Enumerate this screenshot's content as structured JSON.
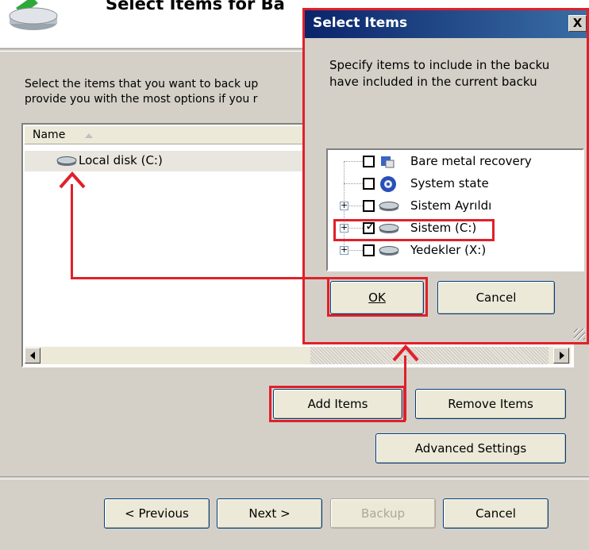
{
  "wizard": {
    "title": "Select Items for Ba",
    "description_line1": "Select the items that you want to back up",
    "description_line2": "provide you with the most options if you r",
    "list": {
      "column_name": "Name",
      "rows": [
        {
          "label": "Local disk (C:)"
        }
      ]
    },
    "buttons": {
      "add_items": "Add Items",
      "remove_items": "Remove Items",
      "advanced_settings": "Advanced Settings",
      "previous": "< Previous",
      "next": "Next >",
      "backup": "Backup",
      "cancel": "Cancel"
    }
  },
  "dialog": {
    "title": "Select Items",
    "close": "X",
    "description_line1": "Specify items to include in the backu",
    "description_line2": "have included in the current backu",
    "tree_items": [
      {
        "label": "Bare metal recovery",
        "checked": false,
        "icon": "bare-metal-icon"
      },
      {
        "label": "System state",
        "checked": false,
        "icon": "system-state-icon"
      },
      {
        "label": "Sistem Ayrıldı",
        "checked": false,
        "icon": "drive-icon"
      },
      {
        "label": "Sistem (C:)",
        "checked": true,
        "icon": "drive-icon"
      },
      {
        "label": "Yedekler (X:)",
        "checked": false,
        "icon": "drive-icon"
      }
    ],
    "ok": "OK",
    "cancel": "Cancel",
    "checkmark": "✓",
    "expander": "+"
  },
  "colors": {
    "annotation_red": "#e0202a",
    "titlebar": "#0a246a"
  }
}
